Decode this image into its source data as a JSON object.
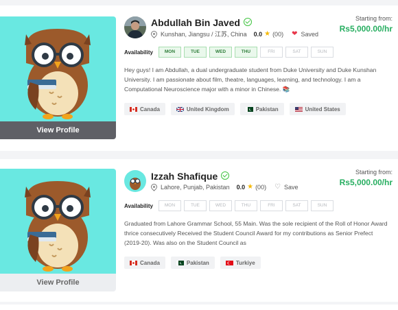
{
  "tutors": [
    {
      "name": "Abdullah Bin Javed",
      "location": "Kunshan, Jiangsu / 江苏, China",
      "rating": "0.0",
      "reviews": "(00)",
      "save_label": "Saved",
      "saved": true,
      "starting_label": "Starting from:",
      "price": "Rs5,000.00/hr",
      "availability_label": "Availability",
      "days": [
        {
          "label": "MON",
          "on": true
        },
        {
          "label": "TUE",
          "on": true
        },
        {
          "label": "WED",
          "on": true
        },
        {
          "label": "THU",
          "on": true
        },
        {
          "label": "FRI",
          "on": false
        },
        {
          "label": "SAT",
          "on": false
        },
        {
          "label": "SUN",
          "on": false
        }
      ],
      "bio": "Hey guys! I am Abdullah, a dual undergraduate student from Duke University and Duke Kunshan University. I am passionate about film, theatre, languages, learning, and technology. I am a Computational Neuroscience major with a minor in Chinese. 📚",
      "countries": [
        "Canada",
        "United Kingdom",
        "Pakistan",
        "United States"
      ],
      "view_profile": "View Profile"
    },
    {
      "name": "Izzah Shafique",
      "location": "Lahore, Punjab, Pakistan",
      "rating": "0.0",
      "reviews": "(00)",
      "save_label": "Save",
      "saved": false,
      "starting_label": "Starting from:",
      "price": "Rs5,000.00/hr",
      "availability_label": "Availability",
      "days": [
        {
          "label": "MON",
          "on": false
        },
        {
          "label": "TUE",
          "on": false
        },
        {
          "label": "WED",
          "on": false
        },
        {
          "label": "THU",
          "on": false
        },
        {
          "label": "FRI",
          "on": false
        },
        {
          "label": "SAT",
          "on": false
        },
        {
          "label": "SUN",
          "on": false
        }
      ],
      "bio": "Graduated from Lahore Grammar School, 55 Main.  Was the sole recipient of the Roll of Honor Award thrice consecutively Received the Student Council Award for my contributions as Senior Prefect (2019-20). Was also on the Student Council as",
      "countries": [
        "Canada",
        "Pakistan",
        "Turkiye"
      ],
      "view_profile": "View Profile"
    }
  ],
  "colors": {
    "photo_bg": "#69e8e1",
    "price": "#27ae60",
    "verified": "#3ec33e",
    "heart": "#e8364a"
  },
  "icons": {
    "verified": "check-circle-icon",
    "location": "map-pin-icon",
    "star": "star-icon",
    "save": "heart-icon"
  }
}
